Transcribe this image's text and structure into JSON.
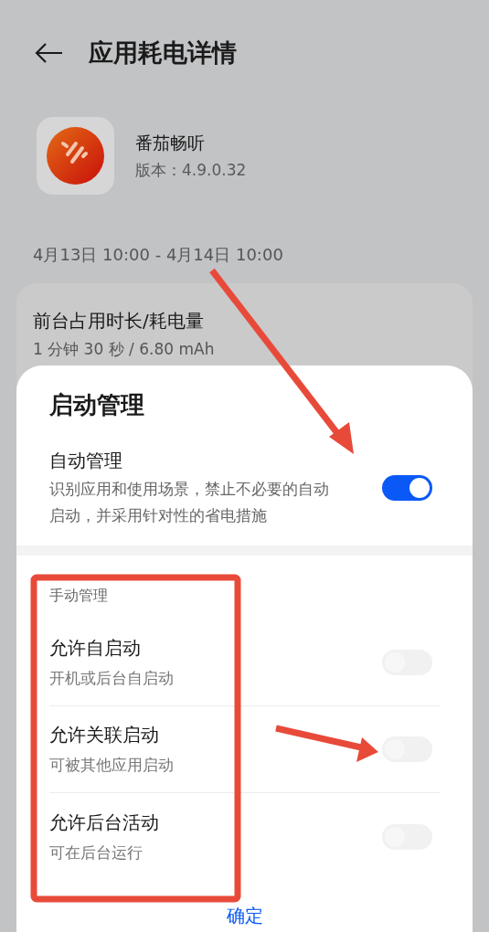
{
  "header": {
    "title": "应用耗电详情"
  },
  "app": {
    "name": "番茄畅听",
    "version": "版本：4.9.0.32"
  },
  "period": "4月13日 10:00 - 4月14日 10:00",
  "usage_card": {
    "title": "前台占用时长/耗电量",
    "value": "1 分钟 30 秒 / 6.80 mAh"
  },
  "sheet": {
    "title": "启动管理",
    "auto": {
      "label": "自动管理",
      "description": "识别应用和使用场景，禁止不必要的自动启动，并采用针对性的省电措施",
      "on": true
    },
    "manual_heading": "手动管理",
    "manual_items": [
      {
        "label": "允许自启动",
        "description": "开机或后台自启动",
        "on": false,
        "disabled": true
      },
      {
        "label": "允许关联启动",
        "description": "可被其他应用启动",
        "on": false,
        "disabled": true
      },
      {
        "label": "允许后台活动",
        "description": "可在后台运行",
        "on": false,
        "disabled": true
      }
    ],
    "confirm": "确定"
  }
}
